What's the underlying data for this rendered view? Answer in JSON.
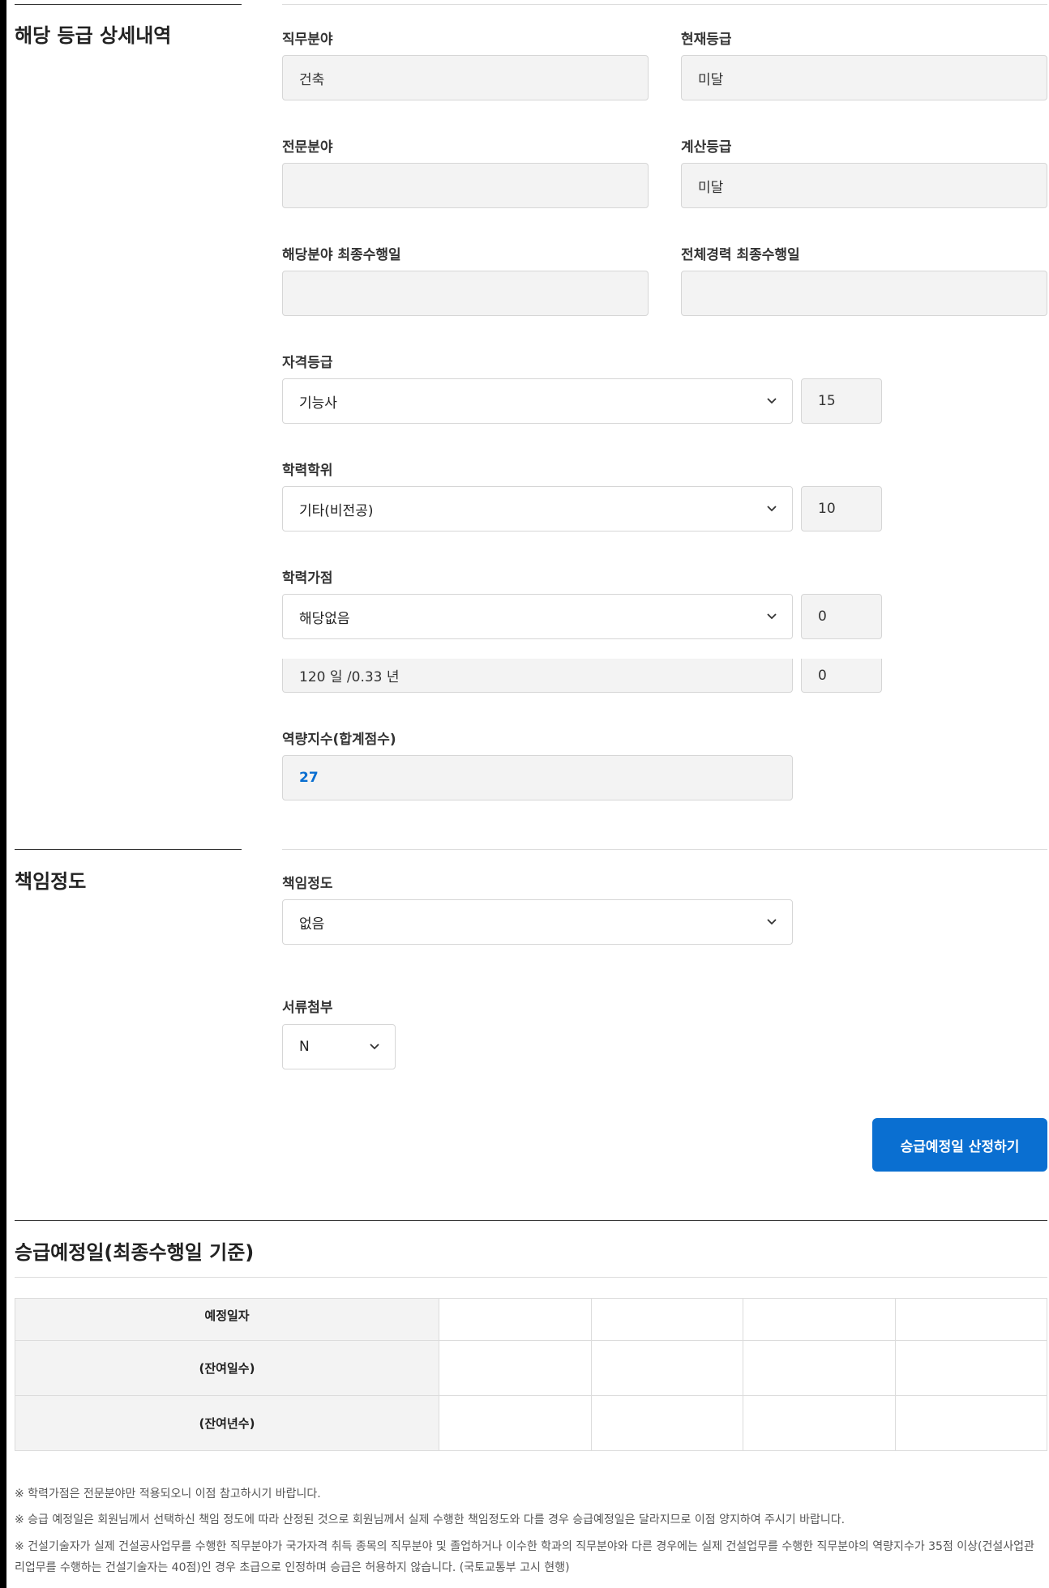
{
  "detail_section": {
    "title": "해당 등급 상세내역",
    "job_field": {
      "label": "직무분야",
      "value": "건축"
    },
    "current_grade": {
      "label": "현재등급",
      "value": "미달"
    },
    "specialty_field": {
      "label": "전문분야",
      "value": ""
    },
    "calculated_grade": {
      "label": "계산등급",
      "value": "미달"
    },
    "field_last_date": {
      "label": "해당분야 최종수행일",
      "value": ""
    },
    "total_last_date": {
      "label": "전체경력 최종수행일",
      "value": ""
    },
    "qualification": {
      "label": "자격등급",
      "selected": "기능사",
      "score": "15"
    },
    "education": {
      "label": "학력학위",
      "selected": "기타(비전공)",
      "score": "10"
    },
    "education_bonus": {
      "label": "학력가점",
      "selected": "해당없음",
      "score": "0"
    },
    "career": {
      "value": "120 일 /0.33 년",
      "score": "0"
    },
    "competency": {
      "label": "역량지수(합계점수)",
      "value": "27"
    }
  },
  "responsibility_section": {
    "title": "책임정도",
    "responsibility": {
      "label": "책임정도",
      "selected": "없음"
    },
    "documents": {
      "label": "서류첨부",
      "selected": "N"
    }
  },
  "calculate_button": "승급예정일 산정하기",
  "result_section": {
    "title": "승급예정일(최종수행일 기준)",
    "rows": [
      "예정일자",
      "(잔여일수)",
      "(잔여년수)"
    ]
  },
  "notes": [
    "※ 학력가점은 전문분야만 적용되오니 이점 참고하시기 바랍니다.",
    "※ 승급 예정일은 회원님께서 선택하신 책임 정도에 따라 산정된 것으로 회원님께서 실제 수행한 책임정도와 다를 경우 승급예정일은 달라지므로 이점 양지하여 주시기 바랍니다.",
    "※ 건설기술자가 실제 건설공사업무를 수행한 직무분야가 국가자격 취득 종목의 직무분야 및 졸업하거나 이수한 학과의 직무분야와 다른 경우에는 실제 건설업무를 수행한 직무분야의 역량지수가 35점 이상(건설사업관리업무를 수행하는 건설기술자는 40점)인 경우 초급으로 인정하며 승급은 허용하지 않습니다. (국토교통부 고시 현행)"
  ],
  "colors": {
    "accent": "#0a6fd1",
    "competency_value": "#0a6fd1"
  }
}
